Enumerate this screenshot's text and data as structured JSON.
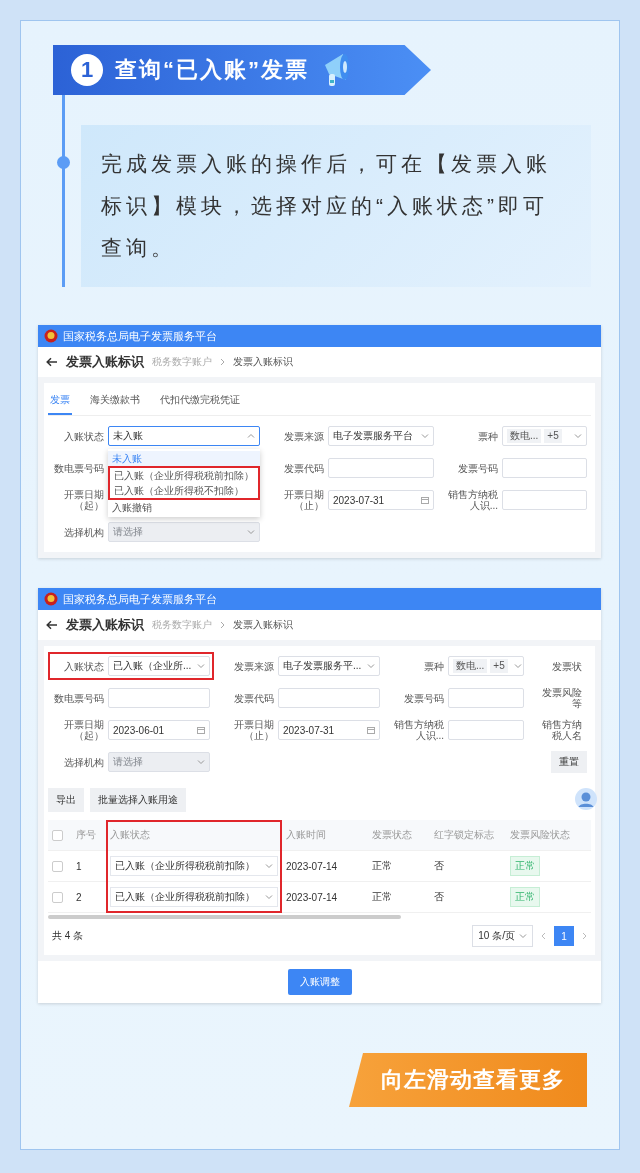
{
  "header": {
    "step": "1",
    "title": "查询“已入账”发票"
  },
  "intro": "完成发票入账的操作后，可在【发票入账标识】模块，选择对应的“入账状态”即可查询。",
  "screens": [
    {
      "platform": "国家税务总局电子发票服务平台",
      "page_title": "发票入账标识",
      "breadcrumb": [
        "税务数字账户",
        "发票入账标识"
      ],
      "tabs": [
        {
          "label": "发票",
          "selected": true
        },
        {
          "label": "海关缴款书",
          "selected": false
        },
        {
          "label": "代扣代缴完税凭证",
          "selected": false
        }
      ],
      "form_rows": [
        [
          {
            "label": "入账状态",
            "kind": "select",
            "value": "未入账",
            "open": true,
            "disabled": false,
            "highlighted": false,
            "options": [
              {
                "label": "未入账",
                "selected": true,
                "highlighted": false
              },
              {
                "label": "已入账（企业所得税税前扣除）",
                "selected": false,
                "highlighted": true
              },
              {
                "label": "已入账（企业所得税不扣除）",
                "selected": false,
                "highlighted": true
              },
              {
                "label": "入账撤销",
                "selected": false,
                "highlighted": false
              }
            ]
          },
          {
            "label": "发票来源",
            "kind": "select",
            "value": "电子发票服务平台",
            "open": false,
            "disabled": false,
            "highlighted": false
          },
          {
            "label": "票种",
            "kind": "tags",
            "tags": [
              "数电...",
              "+5"
            ]
          }
        ],
        [
          {
            "label": "数电票号码",
            "kind": "label_only"
          },
          {
            "label": "发票代码",
            "kind": "input"
          },
          {
            "label": "发票号码",
            "kind": "input"
          }
        ],
        [
          {
            "label": "开票日期（起）",
            "kind": "label_only"
          },
          {
            "label": "开票日期（止）",
            "kind": "date",
            "value": "2023-07-31"
          },
          {
            "label": "销售方纳税人识...",
            "kind": "input"
          }
        ],
        [
          {
            "label": "选择机构",
            "kind": "select",
            "placeholder": "请选择",
            "open": false,
            "disabled": true,
            "highlighted": false
          }
        ]
      ]
    },
    {
      "platform": "国家税务总局电子发票服务平台",
      "page_title": "发票入账标识",
      "breadcrumb": [
        "税务数字账户",
        "发票入账标识"
      ],
      "form_rows": [
        [
          {
            "label": "入账状态",
            "kind": "select",
            "value": "已入账（企业所...",
            "open": false,
            "disabled": false,
            "highlighted": true
          },
          {
            "label": "发票来源",
            "kind": "select",
            "value": "电子发票服务平...",
            "open": false,
            "disabled": false,
            "highlighted": false
          },
          {
            "label": "票种",
            "kind": "tags",
            "tags": [
              "数电...",
              "+5"
            ]
          },
          {
            "label": "发票状",
            "kind": "label_only"
          }
        ],
        [
          {
            "label": "数电票号码",
            "kind": "input"
          },
          {
            "label": "发票代码",
            "kind": "input"
          },
          {
            "label": "发票号码",
            "kind": "input"
          },
          {
            "label": "发票风险等",
            "kind": "label_only"
          }
        ],
        [
          {
            "label": "开票日期（起）",
            "kind": "date",
            "value": "2023-06-01"
          },
          {
            "label": "开票日期（止）",
            "kind": "date",
            "value": "2023-07-31"
          },
          {
            "label": "销售方纳税人识...",
            "kind": "input"
          },
          {
            "label": "销售方纳税人名",
            "kind": "label_only"
          }
        ],
        [
          {
            "label": "选择机构",
            "kind": "select",
            "placeholder": "请选择",
            "open": false,
            "disabled": true,
            "highlighted": false
          },
          {
            "label": "重置",
            "kind": "button"
          }
        ]
      ],
      "actions": [
        "导出",
        "批量选择入账用途"
      ],
      "table": {
        "all_checked": false,
        "columns": [
          {
            "label": "序号",
            "kind": "text",
            "highlighted": false
          },
          {
            "label": "入账状态",
            "kind": "select",
            "highlighted": true
          },
          {
            "label": "入账时间",
            "kind": "text",
            "highlighted": false
          },
          {
            "label": "发票状态",
            "kind": "text",
            "highlighted": false
          },
          {
            "label": "红字锁定标志",
            "kind": "text",
            "highlighted": false
          },
          {
            "label": "发票风险状态",
            "kind": "tag",
            "highlighted": false
          }
        ],
        "rows": [
          {
            "checked": false,
            "cells": [
              "1",
              "已入账（企业所得税税前扣除）",
              "2023-07-14",
              "正常",
              "否",
              "正常"
            ]
          },
          {
            "checked": false,
            "cells": [
              "2",
              "已入账（企业所得税税前扣除）",
              "2023-07-14",
              "正常",
              "否",
              "正常"
            ]
          }
        ]
      },
      "pagination": {
        "total": "共 4 条",
        "page_size": "10 条/页",
        "pages": [
          {
            "label": "1",
            "selected": true
          }
        ]
      },
      "submit": "入账调整"
    }
  ],
  "swipe_hint": "向左滑动查看更多"
}
